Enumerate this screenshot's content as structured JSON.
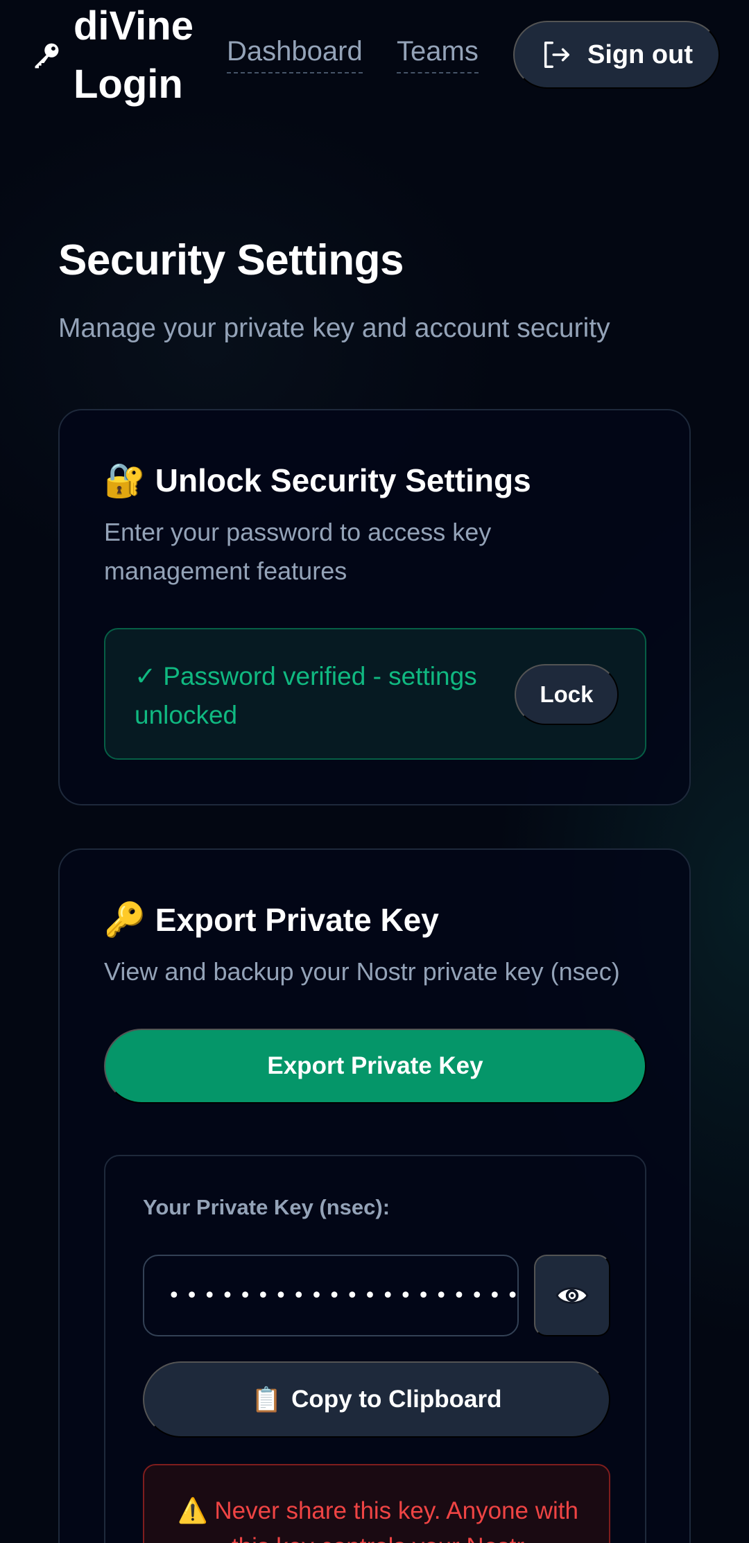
{
  "header": {
    "brand": "diVine Login",
    "brand_icon": "key-icon",
    "nav": [
      {
        "label": "Dashboard"
      },
      {
        "label": "Teams"
      }
    ],
    "signout_label": "Sign out",
    "signout_icon": "sign-out-icon"
  },
  "page": {
    "title": "Security Settings",
    "subtitle": "Manage your private key and account security"
  },
  "unlock_card": {
    "icon": "🔐",
    "title": "Unlock Security Settings",
    "description": "Enter your password to access key management features",
    "status_text": "✓ Password verified - settings unlocked",
    "lock_label": "Lock"
  },
  "export_card": {
    "icon": "🔑",
    "title": "Export Private Key",
    "description": "View and backup your Nostr private key (nsec)",
    "export_label": "Export Private Key",
    "key_label": "Your Private Key (nsec):",
    "key_value_masked": "•••••••••••••••••••••",
    "reveal_icon": "eye-icon",
    "copy_icon": "📋",
    "copy_label": "Copy to Clipboard",
    "warning_icon": "⚠️",
    "warning_text": "Never share this key. Anyone with this key controls your Nostr"
  },
  "colors": {
    "background": "#030712",
    "accent_green": "#059669",
    "success_text": "#10b981",
    "danger_text": "#ef4444",
    "muted_text": "#94a3b8",
    "button_dark": "#1e293b"
  }
}
